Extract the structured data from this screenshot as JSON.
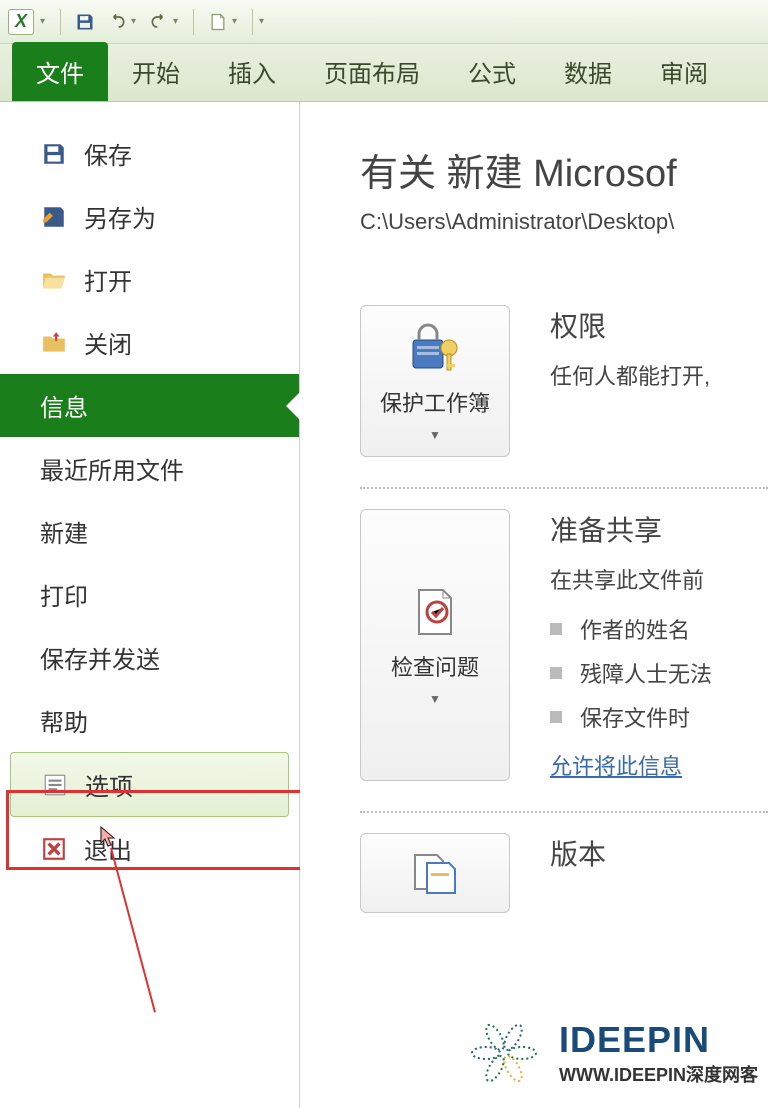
{
  "qat": {
    "app_letter": "X"
  },
  "ribbon": {
    "tabs": [
      "文件",
      "开始",
      "插入",
      "页面布局",
      "公式",
      "数据",
      "审阅"
    ]
  },
  "sidebar": {
    "save": "保存",
    "save_as": "另存为",
    "open": "打开",
    "close": "关闭",
    "info": "信息",
    "recent": "最近所用文件",
    "new": "新建",
    "print": "打印",
    "save_send": "保存并发送",
    "help": "帮助",
    "options": "选项",
    "exit": "退出"
  },
  "content": {
    "title": "有关 新建 Microsof",
    "path": "C:\\Users\\Administrator\\Desktop\\",
    "permissions": {
      "heading": "权限",
      "desc": "任何人都能打开,",
      "button": "保护工作簿"
    },
    "prepare": {
      "heading": "准备共享",
      "desc": "在共享此文件前",
      "button": "检查问题",
      "items": [
        "作者的姓名",
        "残障人士无法",
        "保存文件时"
      ],
      "link": "允许将此信息"
    },
    "versions": {
      "heading": "版本"
    }
  },
  "watermark": {
    "brand": "IDEEPIN",
    "url": "WWW.IDEEPIN深度网客"
  }
}
